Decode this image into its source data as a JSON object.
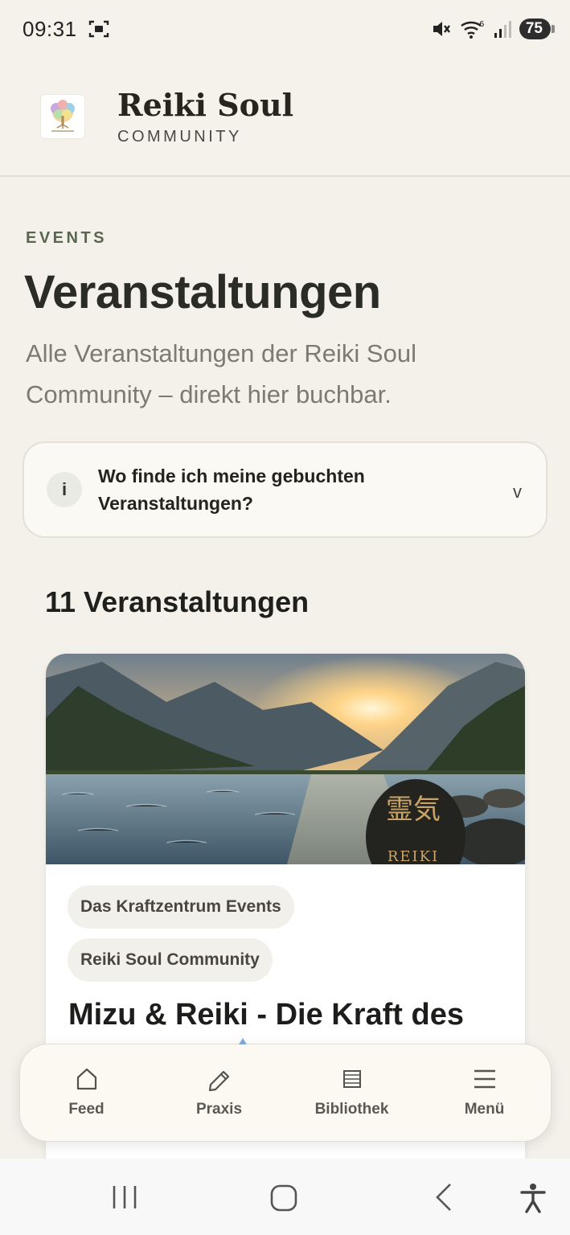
{
  "status_bar": {
    "time": "09:31",
    "battery": "75",
    "network_label": "6",
    "icons": [
      "screenshot-icon",
      "mute-icon",
      "wifi-icon",
      "signal-icon",
      "battery-icon"
    ]
  },
  "app": {
    "title": "Reiki Soul",
    "subtitle": "COMMUNITY",
    "logo": "tree-of-life-logo"
  },
  "page": {
    "eyebrow": "EVENTS",
    "title": "Veranstaltungen",
    "description": "Alle Veranstaltungen der Reiki Soul Community – direkt hier buchbar."
  },
  "info_box": {
    "icon_text": "i",
    "question": "Wo finde ich meine gebuchten Veranstaltungen?",
    "chevron": "v"
  },
  "events": {
    "count_heading": "11 Veranstaltungen",
    "items": [
      {
        "tags": [
          "Das Kraftzentrum Events",
          "Reiki Soul Community"
        ],
        "title": "Mizu & Reiki - Die Kraft des",
        "image": "mountain-lake-sunset-reiki-stone",
        "image_stone_text": "REIKI",
        "image_kanji": "霊気"
      }
    ]
  },
  "bottom_nav": {
    "items": [
      {
        "label": "Feed",
        "icon": "home-icon"
      },
      {
        "label": "Praxis",
        "icon": "pencil-icon"
      },
      {
        "label": "Bibliothek",
        "icon": "library-icon"
      },
      {
        "label": "Menü",
        "icon": "menu-icon"
      }
    ]
  },
  "system_nav": {
    "buttons": [
      "recent-apps-icon",
      "home-circle-icon",
      "back-icon",
      "accessibility-icon"
    ]
  },
  "colors": {
    "background": "#f3f1ea",
    "accent_green": "#5a6650",
    "card": "#ffffff",
    "nav_bg": "#fbf9f2"
  }
}
